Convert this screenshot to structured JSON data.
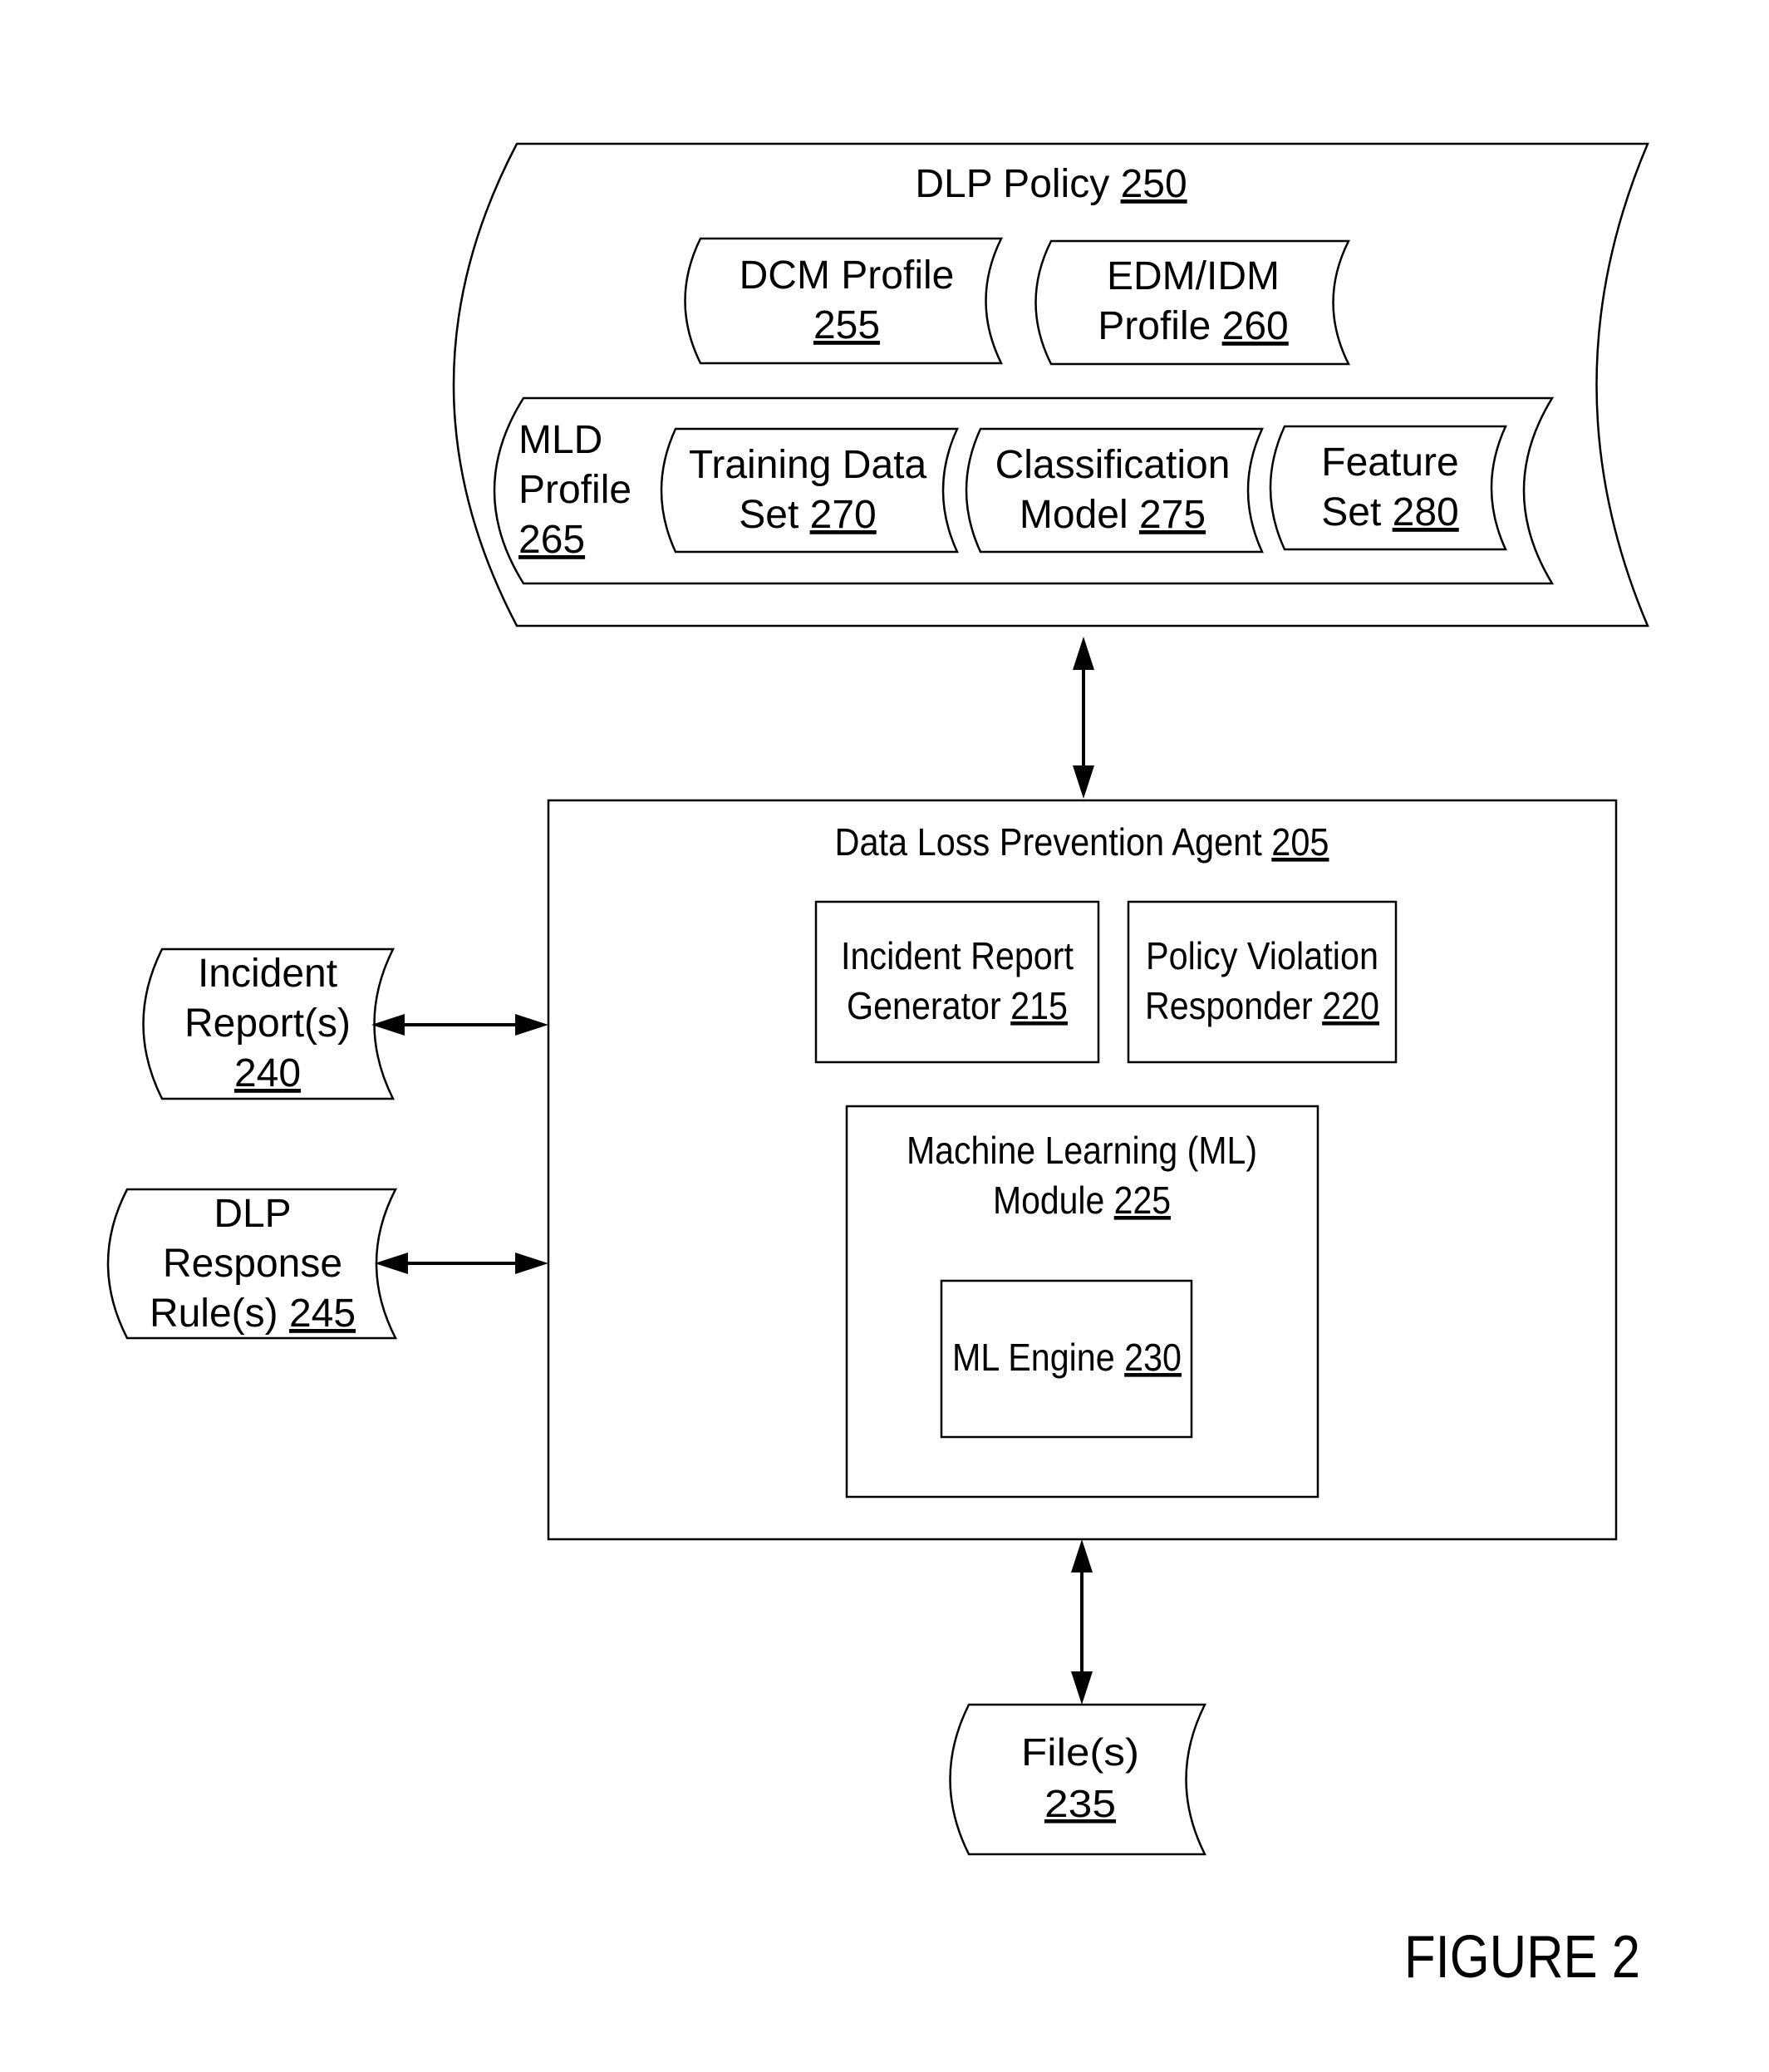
{
  "figure_label": "FIGURE 2",
  "dlp_policy": {
    "label": "DLP Policy",
    "ref": "250"
  },
  "dcm_profile": {
    "line1": "DCM Profile",
    "ref": "255"
  },
  "edm_idm_profile": {
    "line1": "EDM/IDM",
    "line2": "Profile",
    "ref": "260"
  },
  "mld_profile": {
    "line1": "MLD",
    "line2": "Profile",
    "ref": "265"
  },
  "training_data_set": {
    "line1": "Training Data",
    "line2": "Set",
    "ref": "270"
  },
  "classification_model": {
    "line1": "Classification",
    "line2": "Model",
    "ref": "275"
  },
  "feature_set": {
    "line1": "Feature",
    "line2": "Set",
    "ref": "280"
  },
  "dlp_agent": {
    "label": "Data Loss Prevention Agent",
    "ref": "205"
  },
  "incident_report_generator": {
    "line1": "Incident Report",
    "line2": "Generator",
    "ref": "215"
  },
  "policy_violation_responder": {
    "line1": "Policy Violation",
    "line2": "Responder",
    "ref": "220"
  },
  "ml_module": {
    "line1": "Machine Learning (ML)",
    "line2": "Module",
    "ref": "225"
  },
  "ml_engine": {
    "label": "ML Engine",
    "ref": "230"
  },
  "files": {
    "line1": "File(s)",
    "ref": "235"
  },
  "incident_reports": {
    "line1": "Incident",
    "line2": "Report(s)",
    "ref": "240"
  },
  "dlp_response_rules": {
    "line1": "DLP",
    "line2": "Response",
    "line3": "Rule(s)",
    "ref": "245"
  },
  "connections": [
    {
      "from": "dlp-policy",
      "to": "dlp-agent",
      "type": "bidirectional"
    },
    {
      "from": "incident-reports",
      "to": "dlp-agent",
      "type": "bidirectional"
    },
    {
      "from": "dlp-response-rules",
      "to": "dlp-agent",
      "type": "bidirectional"
    },
    {
      "from": "dlp-agent",
      "to": "files",
      "type": "bidirectional"
    }
  ]
}
